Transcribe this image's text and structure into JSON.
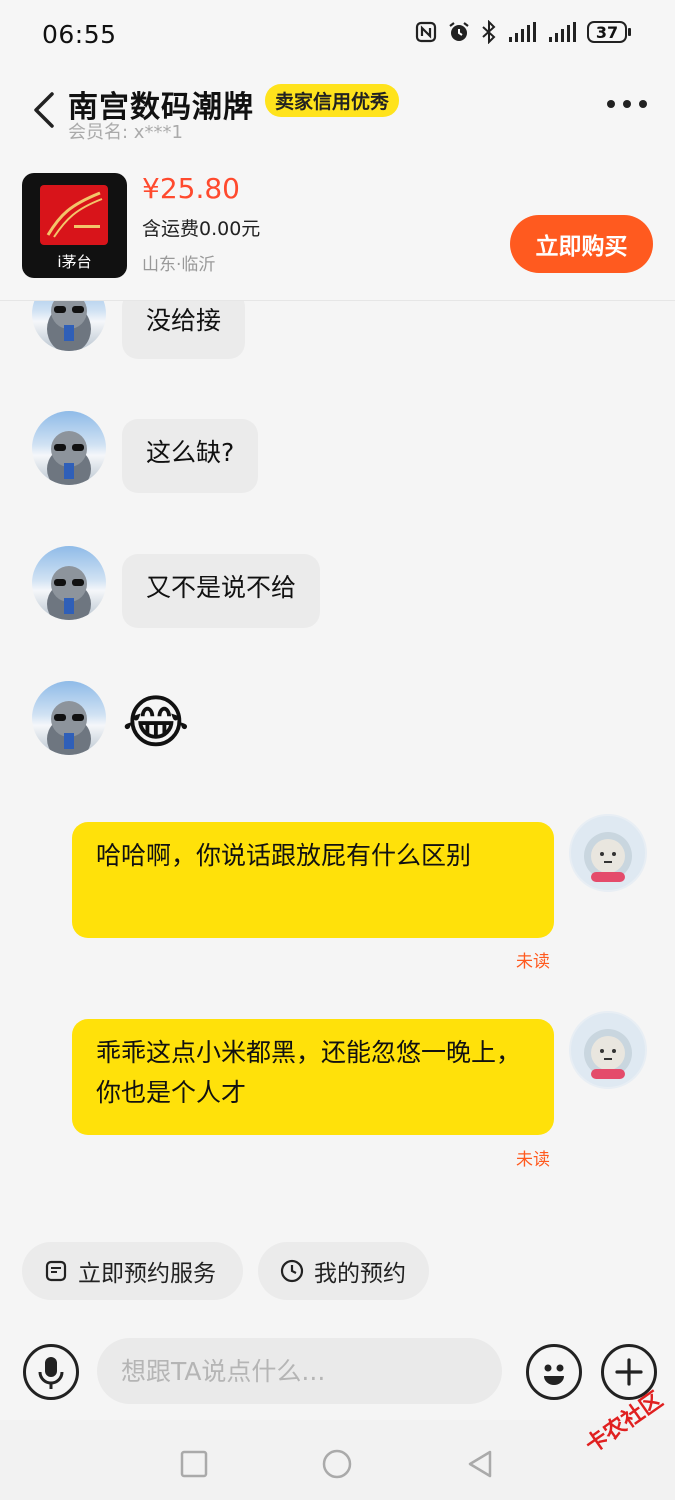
{
  "status_bar": {
    "time": "06:55",
    "battery": "37"
  },
  "header": {
    "shop_name": "南宫数码潮牌",
    "badge": "卖家信用优秀",
    "member_label": "会员名: x***1"
  },
  "product": {
    "thumb_label": "i茅台",
    "price": "¥25.80",
    "shipping": "含运费0.00元",
    "location": "山东·临沂",
    "buy_label": "立即购买"
  },
  "messages": [
    {
      "side": "in",
      "text": "没给接"
    },
    {
      "side": "in",
      "text": "这么缺?"
    },
    {
      "side": "in",
      "text": "又不是说不给"
    },
    {
      "side": "in",
      "emoji": "😂"
    },
    {
      "side": "out",
      "text": "哈哈啊，你说话跟放屁有什么区别",
      "status": "未读"
    },
    {
      "side": "out",
      "text": "乖乖这点小米都黑，还能忽悠一晚上，你也是个人才",
      "status": "未读"
    }
  ],
  "quick_actions": [
    {
      "label": "立即预约服务",
      "icon": "calendar-note-icon"
    },
    {
      "label": "我的预约",
      "icon": "clock-icon"
    }
  ],
  "input": {
    "placeholder": "想跟TA说点什么..."
  },
  "watermark": "卡农社区",
  "colors": {
    "accent": "#ff5a1f",
    "bubble_out": "#ffe10a",
    "bubble_in": "#ebebeb",
    "price": "#ff4a2e",
    "badge": "#ffe31c"
  }
}
